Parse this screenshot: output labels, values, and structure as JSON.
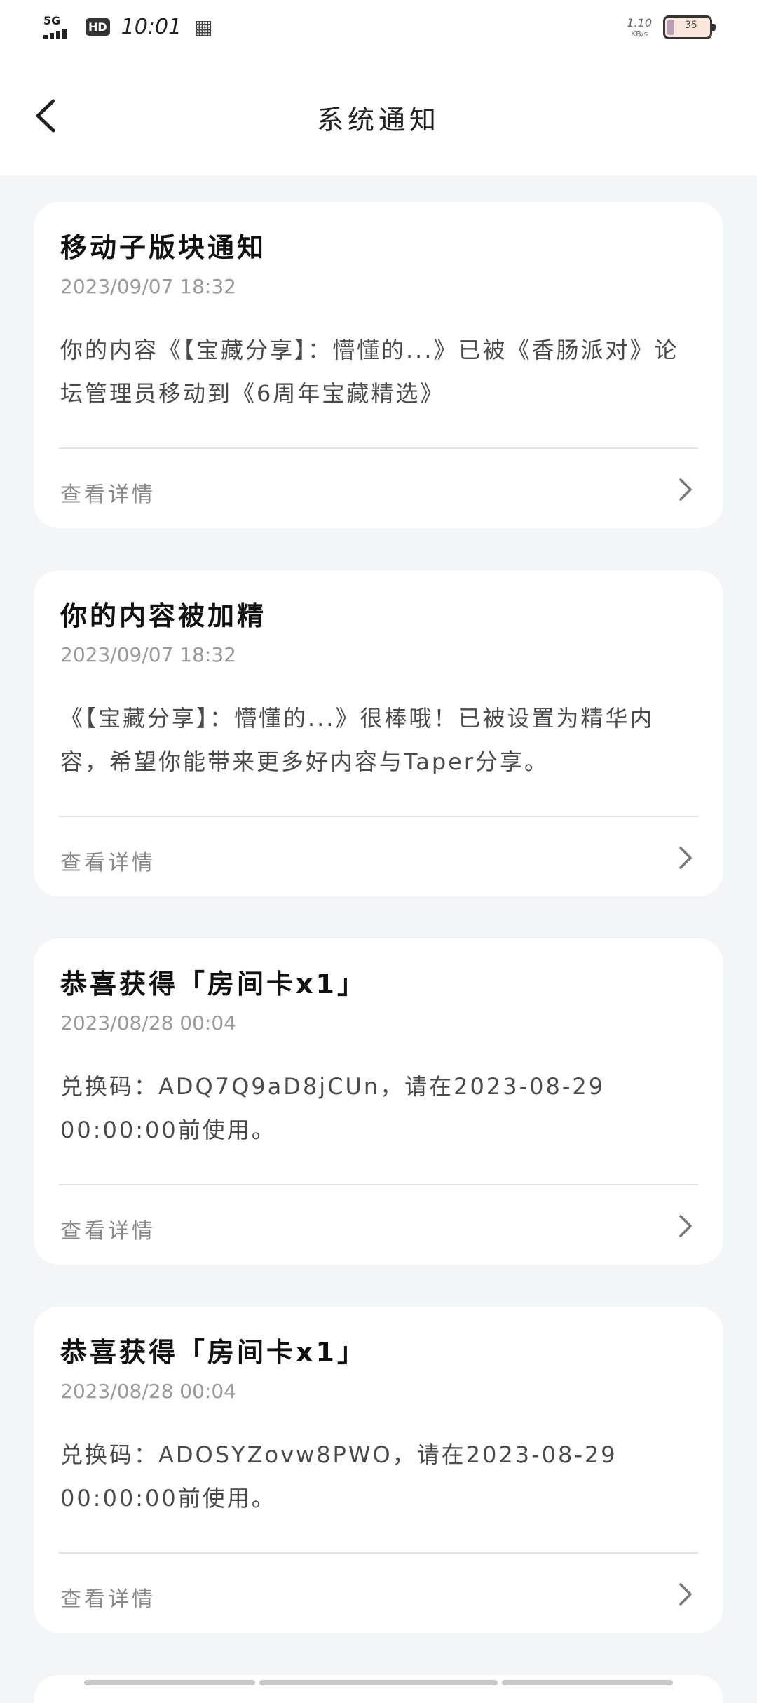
{
  "status_bar": {
    "network": "5G",
    "hd": "HD",
    "time": "10:01",
    "speed_value": "1.10",
    "speed_unit": "KB/s",
    "battery": "35",
    "notification_icon": "s-badge-icon"
  },
  "header": {
    "title": "系统通知",
    "back_icon": "chevron-left-icon"
  },
  "notifications": [
    {
      "title": "移动子版块通知",
      "time": "2023/09/07 18:32",
      "body": "你的内容《【宝藏分享】：懵懂的...》已被《香肠派对》论坛管理员移动到《6周年宝藏精选》",
      "detail": "查看详情"
    },
    {
      "title": "你的内容被加精",
      "time": "2023/09/07 18:32",
      "body": "《【宝藏分享】：懵懂的...》很棒哦！已被设置为精华内容，希望你能带来更多好内容与Taper分享。",
      "detail": "查看详情"
    },
    {
      "title": "恭喜获得「房间卡x1」",
      "time": "2023/08/28 00:04",
      "body": "兑换码：ADQ7Q9aD8jCUn，请在2023-08-29 00:00:00前使用。",
      "detail": "查看详情"
    },
    {
      "title": "恭喜获得「房间卡x1」",
      "time": "2023/08/28 00:04",
      "body": "兑换码：ADOSYZovw8PWO，请在2023-08-29 00:00:00前使用。",
      "detail": "查看详情"
    }
  ],
  "colors": {
    "background": "#f4f5f7",
    "card": "#ffffff",
    "title": "#111111",
    "muted": "#9a9a9a"
  }
}
